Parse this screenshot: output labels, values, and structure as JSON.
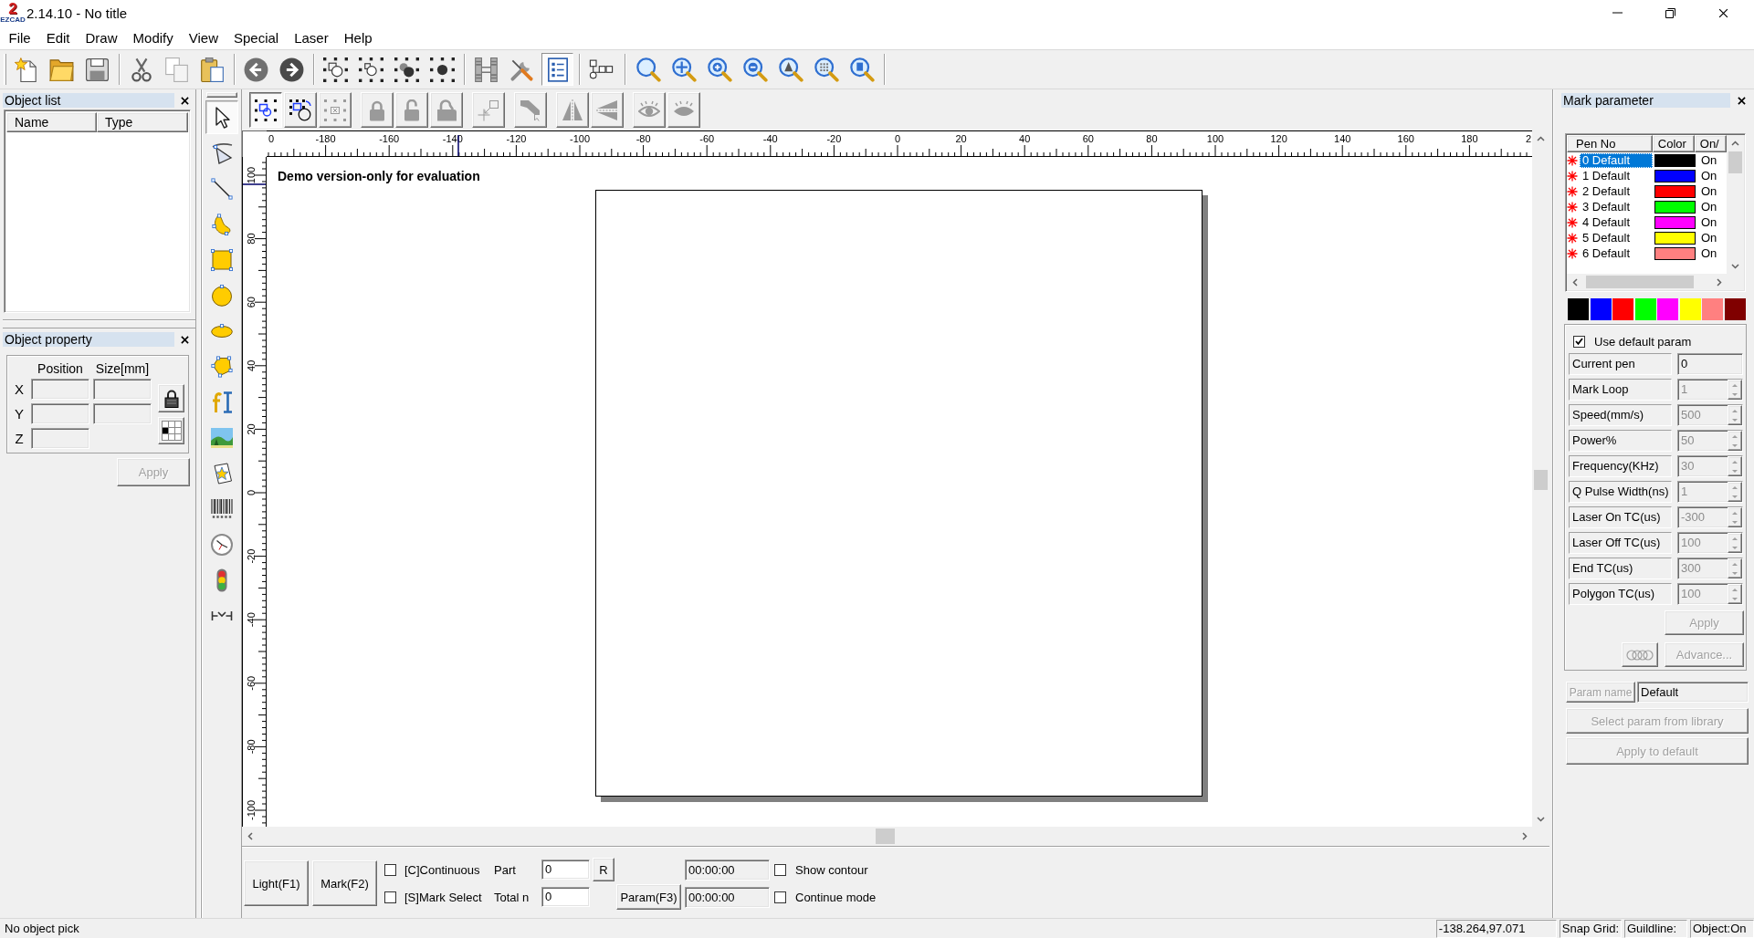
{
  "window": {
    "logo_numeral": "2",
    "logo_caption": "EZCAD",
    "title": "2.14.10 - No title"
  },
  "menu": [
    "File",
    "Edit",
    "Draw",
    "Modify",
    "View",
    "Special",
    "Laser",
    "Help"
  ],
  "main_toolbar": [
    [
      {
        "kind": "new",
        "pressed": false
      },
      {
        "kind": "open",
        "pressed": false
      },
      {
        "kind": "save",
        "pressed": false
      }
    ],
    [
      {
        "kind": "cut",
        "pressed": false
      },
      {
        "kind": "copy",
        "pressed": false
      },
      {
        "kind": "paste",
        "pressed": false
      }
    ],
    [
      {
        "kind": "back",
        "pressed": false
      },
      {
        "kind": "forward",
        "pressed": false
      }
    ],
    [
      {
        "kind": "select_frame",
        "pressed": false
      },
      {
        "kind": "select_frame_small",
        "pressed": false
      },
      {
        "kind": "select_solid",
        "pressed": false
      },
      {
        "kind": "select_solid_small",
        "pressed": false
      }
    ],
    [
      {
        "kind": "hatch",
        "pressed": false
      },
      {
        "kind": "tools",
        "pressed": false
      },
      {
        "kind": "list",
        "pressed": true
      }
    ],
    [
      {
        "kind": "nodes",
        "pressed": false
      }
    ],
    [
      {
        "kind": "zoom",
        "pressed": false
      },
      {
        "kind": "zoom_all",
        "pressed": false
      },
      {
        "kind": "zoom_in",
        "pressed": false
      },
      {
        "kind": "zoom_out",
        "pressed": false
      },
      {
        "kind": "zoom_letter",
        "pressed": false
      },
      {
        "kind": "zoom_dots",
        "pressed": false
      },
      {
        "kind": "zoom_page",
        "pressed": false
      }
    ]
  ],
  "object_list": {
    "title": "Object list",
    "columns": [
      "Name",
      "Type"
    ]
  },
  "object_property": {
    "title": "Object property",
    "headings": [
      "Position",
      "Size[mm]"
    ],
    "rows": [
      {
        "label": "X",
        "kind": "position_size"
      },
      {
        "label": "Y",
        "kind": "position_size"
      },
      {
        "label": "Z",
        "kind": "position"
      }
    ],
    "apply": {
      "label": "Apply",
      "disabled": true
    }
  },
  "draw_tools": [
    {
      "kind": "pointer",
      "selected": true
    },
    {
      "kind": "node_edit",
      "selected": false
    },
    {
      "kind": "line",
      "selected": false
    },
    {
      "kind": "curve",
      "selected": false
    },
    {
      "kind": "rectangle",
      "selected": false
    },
    {
      "kind": "circle",
      "selected": false
    },
    {
      "kind": "ellipse",
      "selected": false
    },
    {
      "kind": "polygon",
      "selected": false
    },
    {
      "kind": "text",
      "selected": false
    },
    {
      "kind": "bitmap",
      "selected": false
    },
    {
      "kind": "vector_file",
      "selected": false
    },
    {
      "kind": "barcode",
      "selected": false
    },
    {
      "kind": "timer",
      "selected": false
    },
    {
      "kind": "io_signal",
      "selected": false
    },
    {
      "kind": "extend_axis",
      "selected": false
    }
  ],
  "edit_toolbar": [
    [
      {
        "kind": "group_select",
        "pressed": true,
        "disabled": false
      },
      {
        "kind": "rotate_select",
        "pressed": false,
        "disabled": false
      },
      {
        "kind": "deselect",
        "pressed": false,
        "disabled": true
      }
    ],
    [
      {
        "kind": "lock",
        "pressed": false,
        "disabled": true
      },
      {
        "kind": "unlock",
        "pressed": false,
        "disabled": true
      },
      {
        "kind": "lock_all",
        "pressed": false,
        "disabled": true
      }
    ],
    [
      {
        "kind": "base_point",
        "pressed": false,
        "disabled": true
      }
    ],
    [
      {
        "kind": "arrow_shadow",
        "pressed": false,
        "disabled": true
      }
    ],
    [
      {
        "kind": "mirror_horizontal",
        "pressed": false,
        "disabled": true
      },
      {
        "kind": "mirror_vertical",
        "pressed": false,
        "disabled": true
      }
    ],
    [
      {
        "kind": "show",
        "pressed": false,
        "disabled": true
      },
      {
        "kind": "hide",
        "pressed": false,
        "disabled": true
      }
    ]
  ],
  "canvas": {
    "top_ruler": [
      "0",
      "-180",
      "-160",
      "-140",
      "-120",
      "-100",
      "-80",
      "-60",
      "-40",
      "-20",
      "0",
      "20",
      "40",
      "60",
      "80",
      "100",
      "120",
      "140",
      "160",
      "180",
      "2"
    ],
    "left_ruler": [
      "100",
      "80",
      "60",
      "40",
      "20",
      "0",
      "-20",
      "-40",
      "-60",
      "-80",
      "-100"
    ],
    "notice": "Demo version-only for evaluation"
  },
  "run_controls": {
    "light": "Light(F1)",
    "mark": "Mark(F2)",
    "modes": [
      {
        "label": "[C]Continuous",
        "checked": false
      },
      {
        "label": "[S]Mark Select",
        "checked": false
      }
    ],
    "counters": [
      {
        "label": "Part",
        "value": "0"
      },
      {
        "label": "Total n",
        "value": "0"
      }
    ],
    "reset": "R",
    "param": "Param(F3)",
    "times": [
      "00:00:00",
      "00:00:00"
    ],
    "options": [
      {
        "label": "Show contour",
        "checked": false
      },
      {
        "label": "Continue mode",
        "checked": false
      }
    ]
  },
  "mark_parameter": {
    "title": "Mark parameter",
    "columns": [
      "Pen No",
      "Color",
      "On/"
    ],
    "pens": [
      {
        "name": "0 Default",
        "color": "#000000",
        "status": "On",
        "selected": true
      },
      {
        "name": "1 Default",
        "color": "#0000ff",
        "status": "On",
        "selected": false
      },
      {
        "name": "2 Default",
        "color": "#ff0000",
        "status": "On",
        "selected": false
      },
      {
        "name": "3 Default",
        "color": "#00ff00",
        "status": "On",
        "selected": false
      },
      {
        "name": "4 Default",
        "color": "#ff00ff",
        "status": "On",
        "selected": false
      },
      {
        "name": "5 Default",
        "color": "#ffff00",
        "status": "On",
        "selected": false
      },
      {
        "name": "6 Default",
        "color": "#ff8080",
        "status": "On",
        "selected": false
      }
    ],
    "palette": [
      {
        "color": "#000000"
      },
      {
        "color": "#0000ff"
      },
      {
        "color": "#ff0000"
      },
      {
        "color": "#00ff00"
      },
      {
        "color": "#ff00ff"
      },
      {
        "color": "#ffff00"
      },
      {
        "color": "#ff8080"
      },
      {
        "color": "#800000"
      }
    ],
    "use_default": {
      "label": "Use default param",
      "checked": true
    },
    "params": [
      {
        "label": "Current pen",
        "value": "0",
        "kind": "field",
        "disabled": false
      },
      {
        "label": "Mark Loop",
        "value": "1",
        "kind": "spinner",
        "disabled": true
      },
      {
        "label": "Speed(mm/s)",
        "value": "500",
        "kind": "spinner",
        "disabled": true
      },
      {
        "label": "Power%",
        "value": "50",
        "kind": "spinner",
        "disabled": true
      },
      {
        "label": "Frequency(KHz)",
        "value": "30",
        "kind": "spinner",
        "disabled": true
      },
      {
        "label": "Q Pulse Width(ns)",
        "value": "1",
        "kind": "spinner",
        "disabled": true
      },
      {
        "label": "Laser On TC(us)",
        "value": "-300",
        "kind": "spinner",
        "disabled": true
      },
      {
        "label": "Laser Off TC(us)",
        "value": "100",
        "kind": "spinner",
        "disabled": true
      },
      {
        "label": "End TC(us)",
        "value": "300",
        "kind": "spinner",
        "disabled": true
      },
      {
        "label": "Polygon TC(us)",
        "value": "100",
        "kind": "spinner",
        "disabled": true
      }
    ],
    "apply": {
      "label": "Apply",
      "disabled": true
    },
    "ring_button": {
      "disabled": true
    },
    "advance": {
      "label": "Advance...",
      "disabled": true
    },
    "param_name": {
      "label": "Param name",
      "disabled": true,
      "value": "Default"
    },
    "library_button": {
      "label": "Select param from library",
      "disabled": true
    },
    "default_button": {
      "label": "Apply to default",
      "disabled": true
    }
  },
  "status_bar": {
    "message": "No object pick",
    "panes": [
      "-138.264,97.071",
      "Snap Grid:",
      "Guildline:",
      "Object:On"
    ]
  }
}
